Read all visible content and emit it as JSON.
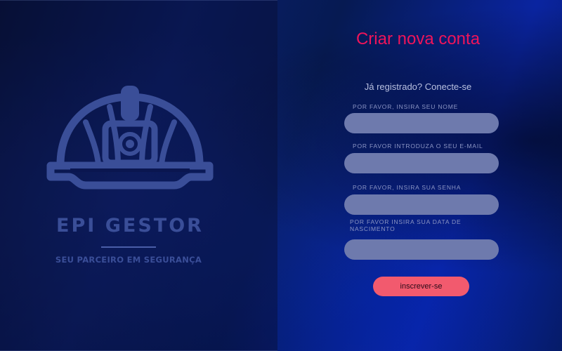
{
  "brand": {
    "name": "EPI GESTOR",
    "tagline": "SEU PARCEIRO EM SEGURANÇA",
    "logo_icon": "hard-hat-icon"
  },
  "form": {
    "title": "Criar nova conta",
    "login_link": "Já registrado? Conecte-se",
    "fields": [
      {
        "label": "POR FAVOR, INSIRA SEU NOME",
        "value": ""
      },
      {
        "label": "POR FAVOR INTRODUZA O SEU E-MAIL",
        "value": ""
      },
      {
        "label": "POR FAVOR, INSIRA SUA SENHA",
        "value": ""
      },
      {
        "label": "POR FAVOR INSIRA SUA DATA DE NASCIMENTO",
        "value": ""
      }
    ],
    "submit_label": "inscrever-se"
  },
  "colors": {
    "title": "#f0145a",
    "button": "#f25a6e",
    "input_fill": "#6e7aad",
    "brand": "#3a4e98"
  }
}
